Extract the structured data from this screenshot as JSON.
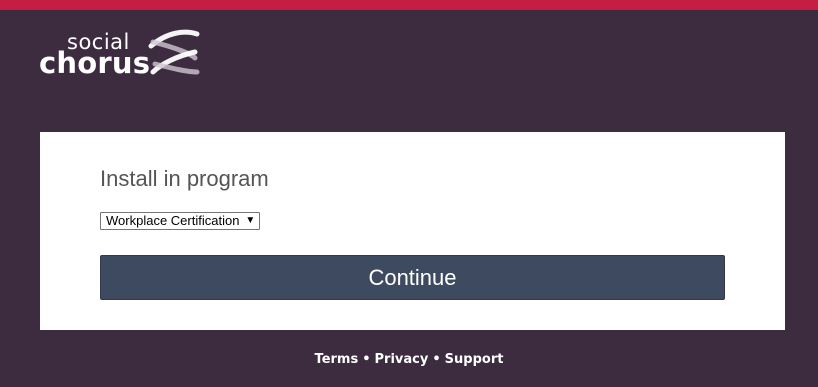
{
  "brand": {
    "logo_word_top": "social",
    "logo_word_bottom": "chorus",
    "accent_color": "#c61e42",
    "background_color": "#3d2b40"
  },
  "form": {
    "heading": "Install in program",
    "program_select": {
      "selected": "Workplace Certification"
    },
    "continue_label": "Continue"
  },
  "footer": {
    "links": [
      "Terms",
      "Privacy",
      "Support"
    ],
    "separator": "•"
  }
}
